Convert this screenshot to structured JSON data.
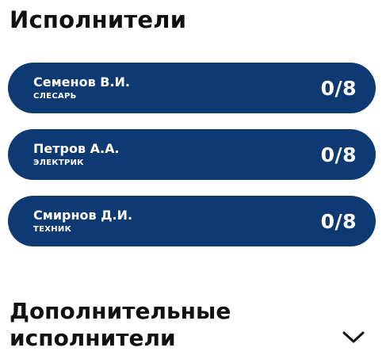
{
  "performers": {
    "title": "Исполнители",
    "items": [
      {
        "name": "Семенов В.И.",
        "role": "СЛЕСАРЬ",
        "count": "0/8"
      },
      {
        "name": "Петров А.А.",
        "role": "ЭЛЕКТРИК",
        "count": "0/8"
      },
      {
        "name": "Смирнов Д.И.",
        "role": "ТЕХНИК",
        "count": "0/8"
      }
    ]
  },
  "additional": {
    "title": "Дополнительные исполнители",
    "icon": "chevron-down-icon"
  },
  "colors": {
    "card_background": "#0d3a73",
    "card_text": "#ffffff",
    "heading_text": "#111111"
  }
}
